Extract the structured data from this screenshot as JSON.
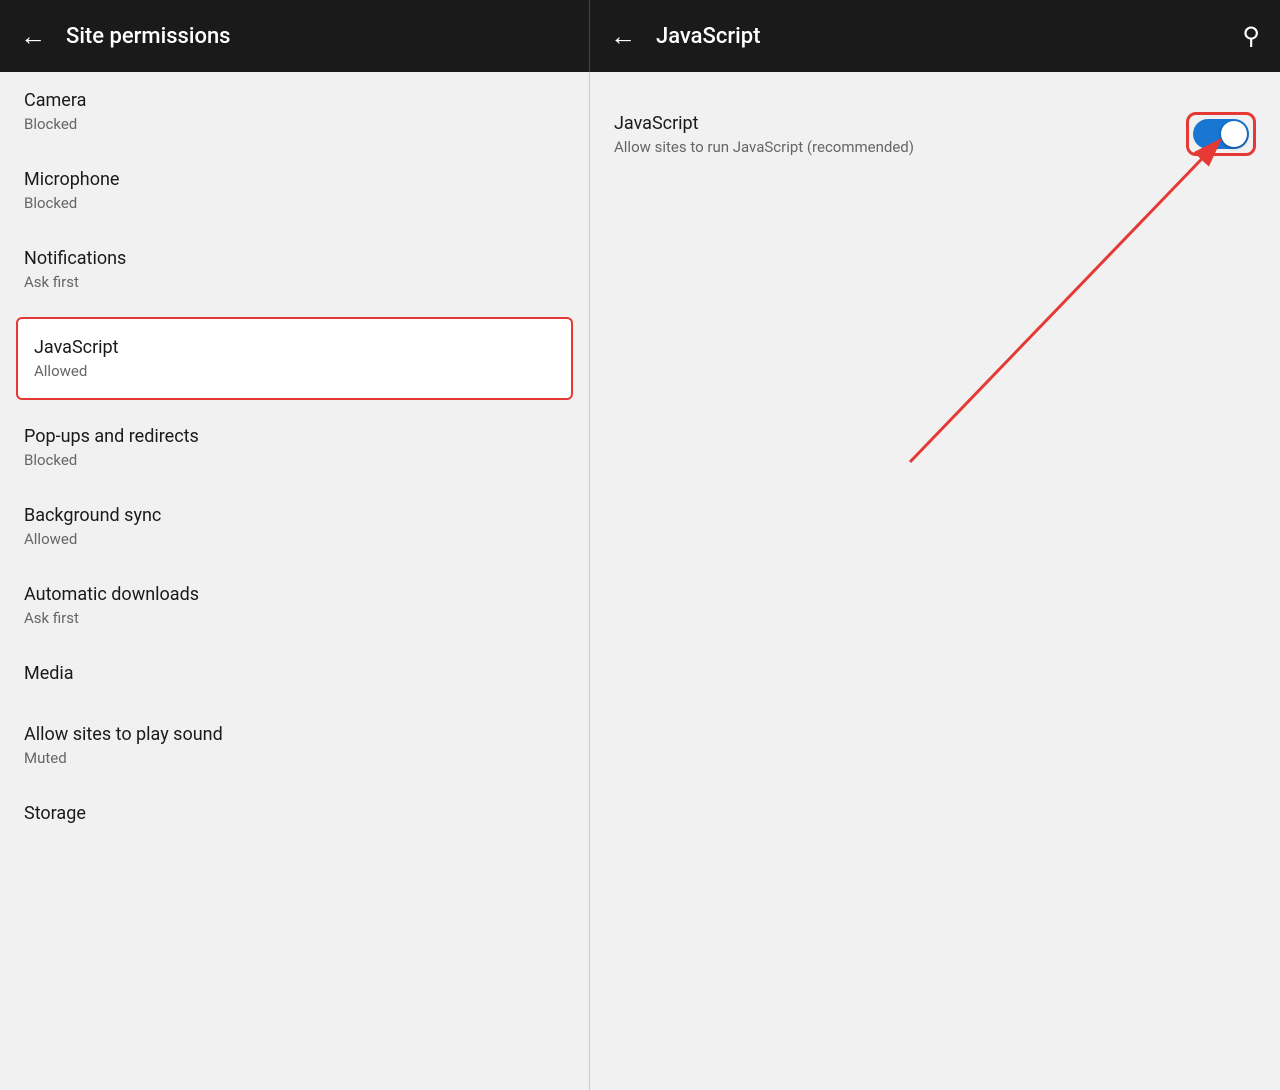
{
  "left_header": {
    "back_icon": "←",
    "title": "Site permissions"
  },
  "right_header": {
    "back_icon": "←",
    "title": "JavaScript",
    "search_icon": "🔍"
  },
  "permissions": [
    {
      "id": "camera",
      "title": "Camera",
      "subtitle": "Blocked",
      "highlighted": false
    },
    {
      "id": "microphone",
      "title": "Microphone",
      "subtitle": "Blocked",
      "highlighted": false
    },
    {
      "id": "notifications",
      "title": "Notifications",
      "subtitle": "Ask first",
      "highlighted": false
    },
    {
      "id": "javascript",
      "title": "JavaScript",
      "subtitle": "Allowed",
      "highlighted": true
    },
    {
      "id": "popups",
      "title": "Pop-ups and redirects",
      "subtitle": "Blocked",
      "highlighted": false
    },
    {
      "id": "background-sync",
      "title": "Background sync",
      "subtitle": "Allowed",
      "highlighted": false
    },
    {
      "id": "automatic-downloads",
      "title": "Automatic downloads",
      "subtitle": "Ask first",
      "highlighted": false
    },
    {
      "id": "media",
      "title": "Media",
      "subtitle": "",
      "highlighted": false
    },
    {
      "id": "sound",
      "title": "Allow sites to play sound",
      "subtitle": "Muted",
      "highlighted": false
    },
    {
      "id": "storage",
      "title": "Storage",
      "subtitle": "",
      "highlighted": false
    }
  ],
  "javascript_setting": {
    "title": "JavaScript",
    "subtitle": "Allow sites to run JavaScript (recommended)",
    "toggle_enabled": true
  }
}
